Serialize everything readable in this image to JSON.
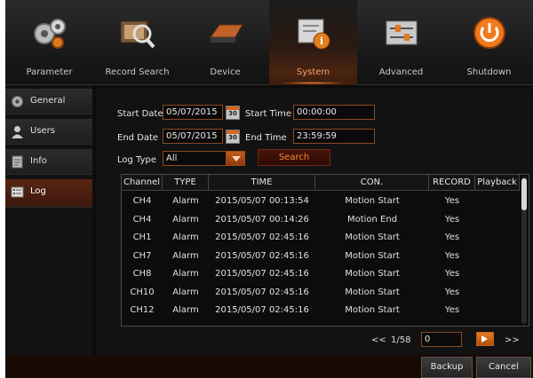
{
  "toolbar": {
    "items": [
      {
        "label": "Parameter",
        "icon": "gears-icon"
      },
      {
        "label": "Record Search",
        "icon": "magnifier-film-icon"
      },
      {
        "label": "Device",
        "icon": "hard-drive-icon"
      },
      {
        "label": "System",
        "icon": "system-info-icon"
      },
      {
        "label": "Advanced",
        "icon": "sliders-icon"
      },
      {
        "label": "Shutdown",
        "icon": "power-icon"
      }
    ],
    "active": "System",
    "accent_color": "#ff8a30"
  },
  "sidebar": {
    "items": [
      {
        "label": "General",
        "icon": "gear-icon"
      },
      {
        "label": "Users",
        "icon": "user-icon"
      },
      {
        "label": "Info",
        "icon": "info-document-icon"
      },
      {
        "label": "Log",
        "icon": "log-list-icon"
      }
    ],
    "active": "Log"
  },
  "filters": {
    "start_date_label": "Start Date",
    "start_date": "05/07/2015",
    "start_time_label": "Start Time",
    "start_time": "00:00:00",
    "end_date_label": "End Date",
    "end_date": "05/07/2015",
    "end_time_label": "End Time",
    "end_time": "23:59:59",
    "log_type_label": "Log Type",
    "log_type": "All",
    "search_label": "Search",
    "calendar_icon_text": "30"
  },
  "table": {
    "columns": [
      "Channel",
      "TYPE",
      "TIME",
      "CON.",
      "RECORD",
      "Playback"
    ],
    "rows": [
      [
        "CH4",
        "Alarm",
        "2015/05/07 00:13:54",
        "Motion Start",
        "Yes",
        ""
      ],
      [
        "CH4",
        "Alarm",
        "2015/05/07 00:14:26",
        "Motion End",
        "Yes",
        ""
      ],
      [
        "CH1",
        "Alarm",
        "2015/05/07 02:45:16",
        "Motion Start",
        "Yes",
        ""
      ],
      [
        "CH7",
        "Alarm",
        "2015/05/07 02:45:16",
        "Motion Start",
        "Yes",
        ""
      ],
      [
        "CH8",
        "Alarm",
        "2015/05/07 02:45:16",
        "Motion Start",
        "Yes",
        ""
      ],
      [
        "CH10",
        "Alarm",
        "2015/05/07 02:45:16",
        "Motion Start",
        "Yes",
        ""
      ],
      [
        "CH12",
        "Alarm",
        "2015/05/07 02:45:16",
        "Motion Start",
        "Yes",
        ""
      ]
    ]
  },
  "pager": {
    "prev_label": "<<",
    "page_text": "1/58",
    "goto_value": "0",
    "next_label": ">>"
  },
  "footer": {
    "backup_label": "Backup",
    "cancel_label": "Cancel"
  }
}
